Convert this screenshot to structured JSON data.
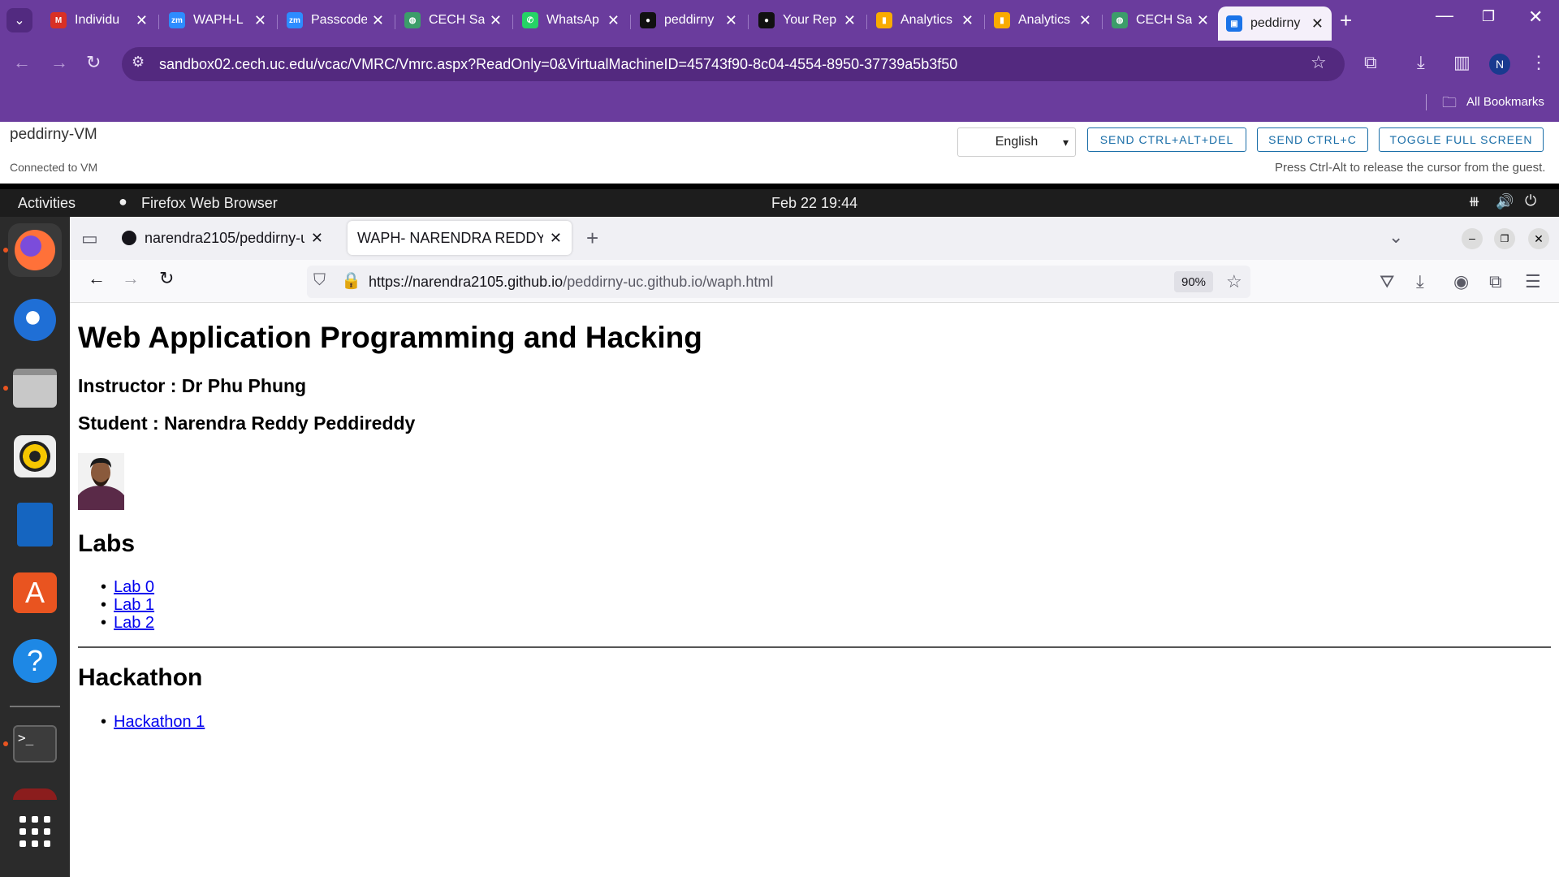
{
  "chrome": {
    "tabs": [
      {
        "title": "Individu",
        "favicon": "mail-favicon",
        "color": "#d93025"
      },
      {
        "title": "WAPH-L",
        "favicon": "zoom-favicon",
        "color": "#2d8cff"
      },
      {
        "title": "Passcode",
        "favicon": "zoom-favicon",
        "color": "#2d8cff"
      },
      {
        "title": "CECH Sa",
        "favicon": "globe-favicon",
        "color": "#3c9d6a"
      },
      {
        "title": "WhatsAp",
        "favicon": "whatsapp-favicon",
        "color": "#25d366"
      },
      {
        "title": "peddirny",
        "favicon": "github-favicon",
        "color": "#111111"
      },
      {
        "title": "Your Rep",
        "favicon": "github-favicon",
        "color": "#111111"
      },
      {
        "title": "Analytics",
        "favicon": "analytics-favicon",
        "color": "#f9ab00"
      },
      {
        "title": "Analytics",
        "favicon": "analytics-favicon",
        "color": "#f9ab00"
      },
      {
        "title": "CECH Sa",
        "favicon": "globe-favicon",
        "color": "#3c9d6a"
      },
      {
        "title": "peddirny",
        "favicon": "monitor-favicon",
        "color": "#1a73e8"
      }
    ],
    "zoom_fav": "zm",
    "close_glyph": "✕",
    "new_tab_glyph": "+",
    "url": "sandbox02.cech.uc.edu/vcac/VMRC/Vmrc.aspx?ReadOnly=0&VirtualMachineID=45743f90-8c04-4554-8950-37739a5b3f50",
    "bookmarks_label": "All Bookmarks",
    "profile_initial": "N",
    "accent": "#6a3c9d"
  },
  "vmrc": {
    "vm_name": "peddirny-VM",
    "status": "Connected to VM",
    "language": "English",
    "btn_ctrl_alt_del": "SEND CTRL+ALT+DEL",
    "btn_ctrl_c": "SEND CTRL+C",
    "btn_fullscreen": "TOGGLE FULL SCREEN",
    "hint": "Press Ctrl-Alt to release the cursor from the guest."
  },
  "ubuntu": {
    "activities": "Activities",
    "app_name": "Firefox Web Browser",
    "datetime": "Feb 22  19:44"
  },
  "firefox": {
    "tabs": [
      {
        "title": "narendra2105/peddirny-u"
      },
      {
        "title": "WAPH- NARENDRA REDDY P"
      }
    ],
    "url_domain": "https://narendra2105.github.io",
    "url_path": "/peddirny-uc.github.io/waph.html",
    "zoom": "90%"
  },
  "page": {
    "title": "Web Application Programming and Hacking",
    "instructor": "Instructor : Dr Phu Phung",
    "student": "Student : Narendra Reddy Peddireddy",
    "labs_heading": "Labs",
    "labs": [
      "Lab 0",
      "Lab 1",
      "Lab 2"
    ],
    "hackathon_heading": "Hackathon",
    "hackathons": [
      "Hackathon 1"
    ]
  }
}
